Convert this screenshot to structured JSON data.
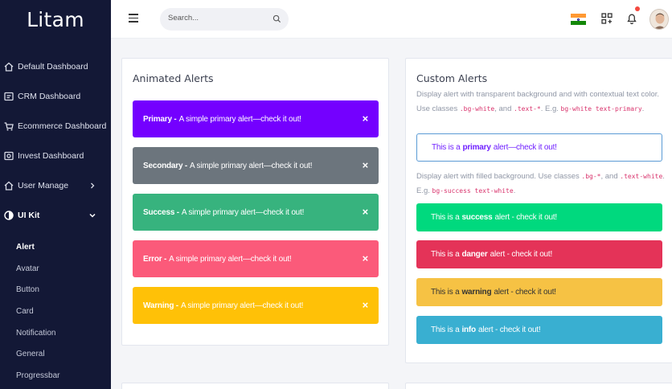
{
  "app": {
    "logo": "Litam"
  },
  "sidebar": {
    "items": [
      {
        "label": "Default Dashboard",
        "icon": "home-icon"
      },
      {
        "label": "CRM Dashboard",
        "icon": "crm-icon"
      },
      {
        "label": "Ecommerce Dashboard",
        "icon": "cart-icon"
      },
      {
        "label": "Invest Dashboard",
        "icon": "invest-icon"
      },
      {
        "label": "User Manage",
        "icon": "user-icon"
      },
      {
        "label": "UI Kit",
        "icon": "ui-kit-icon"
      }
    ],
    "sub_items": [
      "Alert",
      "Avatar",
      "Button",
      "Card",
      "Notification",
      "General",
      "Progressbar"
    ]
  },
  "header": {
    "search_placeholder": "Search..."
  },
  "animated": {
    "title": "Animated Alerts",
    "alerts": [
      {
        "label": "Primary -",
        "text": "A simple primary alert—check it out!",
        "color": "#7400ff",
        "close": "×"
      },
      {
        "label": "Secondary -",
        "text": "A simple primary alert—check it out!",
        "color": "#6c757d",
        "close": "×"
      },
      {
        "label": "Success -",
        "text": "A simple primary alert—check it out!",
        "color": "#37b37e",
        "close": "×"
      },
      {
        "label": "Error -",
        "text": "A simple primary alert—check it out!",
        "color": "#fb5a7a",
        "close": "×"
      },
      {
        "label": "Warning -",
        "text": "A simple primary alert—check it out!",
        "color": "#ffc107",
        "close": "×"
      }
    ]
  },
  "custom": {
    "title": "Custom Alerts",
    "desc1_a": "Display alert with transparent background and with contextual text color. Use classes",
    "desc1_code1": ".bg-white",
    "desc1_b": ", and",
    "desc1_code2": ".text-*",
    "desc1_c": ". E.g.",
    "desc1_code3": "bg-white text-primary",
    "desc1_d": ".",
    "outline": {
      "pre": "This is a",
      "bold": "primary",
      "post": "alert—check it out!",
      "color": "#6f1fff"
    },
    "desc2_a": "Display alert with filled background. Use classes",
    "desc2_code1": ".bg-*",
    "desc2_b": ", and",
    "desc2_code2": ".text-white",
    "desc2_c": ". E.g.",
    "desc2_code3": "bg-success text-white",
    "desc2_d": ".",
    "filled": [
      {
        "pre": "This is a",
        "bold": "success",
        "post": "alert - check it out!",
        "color": "#00d97e",
        "text_color": "#ffffff"
      },
      {
        "pre": "This is a",
        "bold": "danger",
        "post": "alert - check it out!",
        "color": "#e43358",
        "text_color": "#ffffff"
      },
      {
        "pre": "This is a",
        "bold": "warning",
        "post": "alert - check it out!",
        "color": "#f6c244",
        "text_color": "#333333"
      },
      {
        "pre": "This is a",
        "bold": "info",
        "post": "alert - check it out!",
        "color": "#39afd1",
        "text_color": "#ffffff"
      }
    ]
  }
}
